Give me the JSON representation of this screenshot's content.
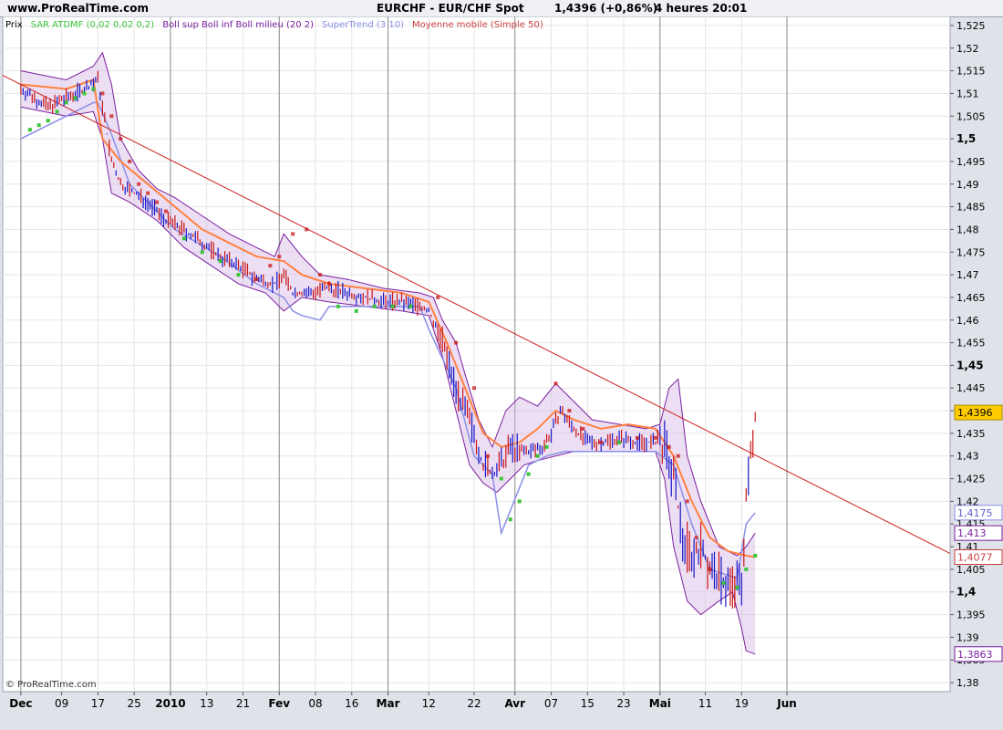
{
  "header": {
    "site": "www.ProRealTime.com",
    "title": "EURCHF - EUR/CHF Spot",
    "price": "1,4396 (+0,86%)",
    "period": "4 heures  20:01"
  },
  "footer": {
    "copyright": "© ProRealTime.com"
  },
  "colors": {
    "background": "#ffffff",
    "grid": "#e6e6e6",
    "month_line": "#888888",
    "candles_up": "#1515c8",
    "candles_down": "#c81515",
    "sar": "#3cc43c",
    "bollinger": "#7a1fa0",
    "bollinger_fill": "#d8b8e4",
    "supertrend": "#8a8fe8",
    "moving_average": "#ff8040",
    "trendline": "#cc2020"
  },
  "chart_data": {
    "type": "line",
    "symbol": "EURCHF",
    "title": "EURCHF - EUR/CHF Spot",
    "legend": [
      {
        "label": "Prix",
        "color": "#000000"
      },
      {
        "label": "SAR ATDMF (0,02 0,02 0,2)",
        "color": "#3cc43c"
      },
      {
        "label": "Boll sup Boll inf Boll milieu (20 2)",
        "color": "#7a1fa0"
      },
      {
        "label": "SuperTrend (3 10)",
        "color": "#8a8fe8"
      },
      {
        "label": "Moyenne mobile (Simple 50)",
        "color": "#cc4040"
      }
    ],
    "y_axis": {
      "position": "right",
      "range": [
        1.378,
        1.527
      ],
      "ticks": [
        "1,525",
        "1,52",
        "1,515",
        "1,51",
        "1,505",
        "1,5",
        "1,495",
        "1,49",
        "1,485",
        "1,48",
        "1,475",
        "1,47",
        "1,465",
        "1,46",
        "1,455",
        "1,45",
        "1,445",
        "1,44",
        "1,435",
        "1,43",
        "1,425",
        "1,42",
        "1,415",
        "1,41",
        "1,405",
        "1,4",
        "1,395",
        "1,39",
        "1,385",
        "1,38"
      ],
      "bold_ticks": [
        "1,5",
        "1,45",
        "1,4"
      ]
    },
    "x_axis": {
      "ticks": [
        "Dec",
        "09",
        "17",
        "25",
        "2010",
        "13",
        "21",
        "Fev",
        "08",
        "16",
        "Mar",
        "12",
        "22",
        "Avr",
        "07",
        "15",
        "23",
        "Mai",
        "11",
        "19",
        "Jun"
      ],
      "bold_ticks": [
        "Dec",
        "2010",
        "Fev",
        "Mar",
        "Avr",
        "Mai",
        "Jun"
      ],
      "tick_index": [
        0,
        9,
        17,
        25,
        33,
        41,
        49,
        57,
        65,
        73,
        81,
        90,
        100,
        109,
        117,
        125,
        133,
        141,
        151,
        159,
        169
      ],
      "index_range": [
        -4,
        205
      ]
    },
    "price_labels": [
      {
        "text": "1,4396",
        "value": 1.4396,
        "style": "current"
      },
      {
        "text": "1,4175",
        "value": 1.4175,
        "style": "supertrend"
      },
      {
        "text": "1,413",
        "value": 1.413,
        "style": "bollinger"
      },
      {
        "text": "1,4077",
        "value": 1.4077,
        "style": "moving_average"
      },
      {
        "text": "1,3863",
        "value": 1.3863,
        "style": "bollinger"
      }
    ],
    "close": [
      [
        0,
        1.511
      ],
      [
        3,
        1.509
      ],
      [
        6,
        1.507
      ],
      [
        10,
        1.509
      ],
      [
        14,
        1.511
      ],
      [
        17,
        1.513
      ],
      [
        20,
        1.495
      ],
      [
        22,
        1.49
      ],
      [
        25,
        1.488
      ],
      [
        28,
        1.486
      ],
      [
        32,
        1.482
      ],
      [
        34,
        1.481
      ],
      [
        37,
        1.479
      ],
      [
        40,
        1.477
      ],
      [
        44,
        1.474
      ],
      [
        48,
        1.472
      ],
      [
        52,
        1.469
      ],
      [
        56,
        1.468
      ],
      [
        58,
        1.47
      ],
      [
        60,
        1.466
      ],
      [
        64,
        1.466
      ],
      [
        68,
        1.467
      ],
      [
        72,
        1.466
      ],
      [
        76,
        1.465
      ],
      [
        80,
        1.464
      ],
      [
        84,
        1.464
      ],
      [
        88,
        1.463
      ],
      [
        90,
        1.462
      ],
      [
        93,
        1.455
      ],
      [
        96,
        1.445
      ],
      [
        98,
        1.44
      ],
      [
        100,
        1.435
      ],
      [
        102,
        1.428
      ],
      [
        104,
        1.426
      ],
      [
        106,
        1.428
      ],
      [
        108,
        1.432
      ],
      [
        110,
        1.431
      ],
      [
        112,
        1.431
      ],
      [
        115,
        1.432
      ],
      [
        117,
        1.435
      ],
      [
        119,
        1.44
      ],
      [
        122,
        1.436
      ],
      [
        125,
        1.433
      ],
      [
        128,
        1.433
      ],
      [
        132,
        1.434
      ],
      [
        136,
        1.433
      ],
      [
        140,
        1.433
      ],
      [
        142,
        1.432
      ],
      [
        144,
        1.425
      ],
      [
        146,
        1.412
      ],
      [
        148,
        1.408
      ],
      [
        150,
        1.41
      ],
      [
        152,
        1.405
      ],
      [
        154,
        1.403
      ],
      [
        157,
        1.401
      ],
      [
        159,
        1.402
      ],
      [
        160,
        1.42
      ],
      [
        162,
        1.4396
      ]
    ],
    "upper_band": [
      [
        0,
        1.515
      ],
      [
        10,
        1.513
      ],
      [
        16,
        1.516
      ],
      [
        18,
        1.519
      ],
      [
        20,
        1.512
      ],
      [
        22,
        1.5
      ],
      [
        26,
        1.493
      ],
      [
        30,
        1.489
      ],
      [
        34,
        1.487
      ],
      [
        40,
        1.483
      ],
      [
        46,
        1.479
      ],
      [
        52,
        1.476
      ],
      [
        56,
        1.474
      ],
      [
        58,
        1.479
      ],
      [
        62,
        1.474
      ],
      [
        66,
        1.47
      ],
      [
        72,
        1.469
      ],
      [
        80,
        1.467
      ],
      [
        88,
        1.466
      ],
      [
        91,
        1.465
      ],
      [
        93,
        1.46
      ],
      [
        96,
        1.455
      ],
      [
        98,
        1.448
      ],
      [
        101,
        1.438
      ],
      [
        104,
        1.432
      ],
      [
        107,
        1.44
      ],
      [
        110,
        1.443
      ],
      [
        114,
        1.441
      ],
      [
        118,
        1.446
      ],
      [
        122,
        1.442
      ],
      [
        126,
        1.438
      ],
      [
        132,
        1.437
      ],
      [
        138,
        1.436
      ],
      [
        141,
        1.437
      ],
      [
        143,
        1.445
      ],
      [
        145,
        1.447
      ],
      [
        147,
        1.43
      ],
      [
        150,
        1.42
      ],
      [
        154,
        1.41
      ],
      [
        158,
        1.408
      ],
      [
        160,
        1.41
      ],
      [
        162,
        1.413
      ]
    ],
    "lower_band": [
      [
        0,
        1.507
      ],
      [
        10,
        1.505
      ],
      [
        16,
        1.506
      ],
      [
        18,
        1.5
      ],
      [
        20,
        1.488
      ],
      [
        24,
        1.486
      ],
      [
        30,
        1.482
      ],
      [
        36,
        1.476
      ],
      [
        42,
        1.472
      ],
      [
        48,
        1.468
      ],
      [
        54,
        1.466
      ],
      [
        58,
        1.462
      ],
      [
        62,
        1.465
      ],
      [
        68,
        1.464
      ],
      [
        76,
        1.463
      ],
      [
        84,
        1.462
      ],
      [
        90,
        1.461
      ],
      [
        93,
        1.452
      ],
      [
        96,
        1.44
      ],
      [
        99,
        1.428
      ],
      [
        102,
        1.424
      ],
      [
        105,
        1.422
      ],
      [
        108,
        1.425
      ],
      [
        111,
        1.428
      ],
      [
        114,
        1.429
      ],
      [
        118,
        1.43
      ],
      [
        122,
        1.431
      ],
      [
        128,
        1.431
      ],
      [
        134,
        1.431
      ],
      [
        140,
        1.431
      ],
      [
        142,
        1.425
      ],
      [
        144,
        1.41
      ],
      [
        147,
        1.398
      ],
      [
        150,
        1.395
      ],
      [
        154,
        1.398
      ],
      [
        157,
        1.4
      ],
      [
        159,
        1.392
      ],
      [
        160,
        1.387
      ],
      [
        162,
        1.3863
      ]
    ],
    "supertrend_line": [
      [
        0,
        1.5
      ],
      [
        10,
        1.505
      ],
      [
        16,
        1.508
      ],
      [
        17,
        1.508
      ],
      [
        20,
        1.501
      ],
      [
        24,
        1.49
      ],
      [
        34,
        1.48
      ],
      [
        44,
        1.474
      ],
      [
        52,
        1.468
      ],
      [
        58,
        1.465
      ],
      [
        60,
        1.462
      ],
      [
        62,
        1.461
      ],
      [
        66,
        1.46
      ],
      [
        68,
        1.463
      ],
      [
        76,
        1.463
      ],
      [
        88,
        1.463
      ],
      [
        90,
        1.458
      ],
      [
        96,
        1.445
      ],
      [
        100,
        1.43
      ],
      [
        104,
        1.426
      ],
      [
        106,
        1.413
      ],
      [
        108,
        1.418
      ],
      [
        112,
        1.428
      ],
      [
        116,
        1.43
      ],
      [
        120,
        1.431
      ],
      [
        128,
        1.431
      ],
      [
        136,
        1.431
      ],
      [
        140,
        1.431
      ],
      [
        144,
        1.428
      ],
      [
        148,
        1.415
      ],
      [
        152,
        1.405
      ],
      [
        158,
        1.403
      ],
      [
        160,
        1.415
      ],
      [
        162,
        1.4175
      ]
    ],
    "moving_average_line": [
      [
        0,
        1.512
      ],
      [
        10,
        1.511
      ],
      [
        16,
        1.513
      ],
      [
        18,
        1.5
      ],
      [
        22,
        1.495
      ],
      [
        28,
        1.49
      ],
      [
        34,
        1.485
      ],
      [
        40,
        1.48
      ],
      [
        46,
        1.477
      ],
      [
        52,
        1.474
      ],
      [
        58,
        1.473
      ],
      [
        62,
        1.47
      ],
      [
        68,
        1.468
      ],
      [
        76,
        1.467
      ],
      [
        84,
        1.466
      ],
      [
        90,
        1.464
      ],
      [
        94,
        1.455
      ],
      [
        98,
        1.445
      ],
      [
        102,
        1.435
      ],
      [
        106,
        1.432
      ],
      [
        110,
        1.433
      ],
      [
        114,
        1.436
      ],
      [
        118,
        1.44
      ],
      [
        122,
        1.438
      ],
      [
        128,
        1.436
      ],
      [
        134,
        1.437
      ],
      [
        140,
        1.436
      ],
      [
        144,
        1.43
      ],
      [
        148,
        1.42
      ],
      [
        152,
        1.412
      ],
      [
        156,
        1.409
      ],
      [
        160,
        1.408
      ],
      [
        162,
        1.4077
      ]
    ],
    "sar_points": [
      [
        2,
        1.502
      ],
      [
        4,
        1.503
      ],
      [
        6,
        1.504
      ],
      [
        8,
        1.506
      ],
      [
        10,
        1.508
      ],
      [
        12,
        1.509
      ],
      [
        14,
        1.51
      ],
      [
        16,
        1.511
      ],
      [
        18,
        1.51
      ],
      [
        20,
        1.505
      ],
      [
        22,
        1.5
      ],
      [
        24,
        1.495
      ],
      [
        26,
        1.49
      ],
      [
        28,
        1.488
      ],
      [
        30,
        1.486
      ],
      [
        32,
        1.484
      ],
      [
        36,
        1.478
      ],
      [
        40,
        1.475
      ],
      [
        44,
        1.473
      ],
      [
        48,
        1.47
      ],
      [
        52,
        1.469
      ],
      [
        55,
        1.472
      ],
      [
        57,
        1.474
      ],
      [
        60,
        1.479
      ],
      [
        63,
        1.48
      ],
      [
        66,
        1.47
      ],
      [
        68,
        1.468
      ],
      [
        70,
        1.463
      ],
      [
        74,
        1.462
      ],
      [
        78,
        1.463
      ],
      [
        82,
        1.463
      ],
      [
        86,
        1.463
      ],
      [
        92,
        1.465
      ],
      [
        96,
        1.455
      ],
      [
        100,
        1.445
      ],
      [
        103,
        1.43
      ],
      [
        106,
        1.425
      ],
      [
        108,
        1.416
      ],
      [
        110,
        1.42
      ],
      [
        112,
        1.426
      ],
      [
        114,
        1.43
      ],
      [
        116,
        1.432
      ],
      [
        118,
        1.446
      ],
      [
        121,
        1.44
      ],
      [
        124,
        1.436
      ],
      [
        128,
        1.433
      ],
      [
        132,
        1.433
      ],
      [
        136,
        1.434
      ],
      [
        140,
        1.434
      ],
      [
        143,
        1.432
      ],
      [
        145,
        1.43
      ],
      [
        147,
        1.42
      ],
      [
        149,
        1.412
      ],
      [
        152,
        1.405
      ],
      [
        155,
        1.402
      ],
      [
        158,
        1.401
      ],
      [
        160,
        1.405
      ],
      [
        162,
        1.408
      ]
    ],
    "trendline": [
      [
        -4,
        1.514
      ],
      [
        205,
        1.4085
      ]
    ],
    "ohlc_style": "bar",
    "grid": true,
    "legend_position": "top-left"
  }
}
